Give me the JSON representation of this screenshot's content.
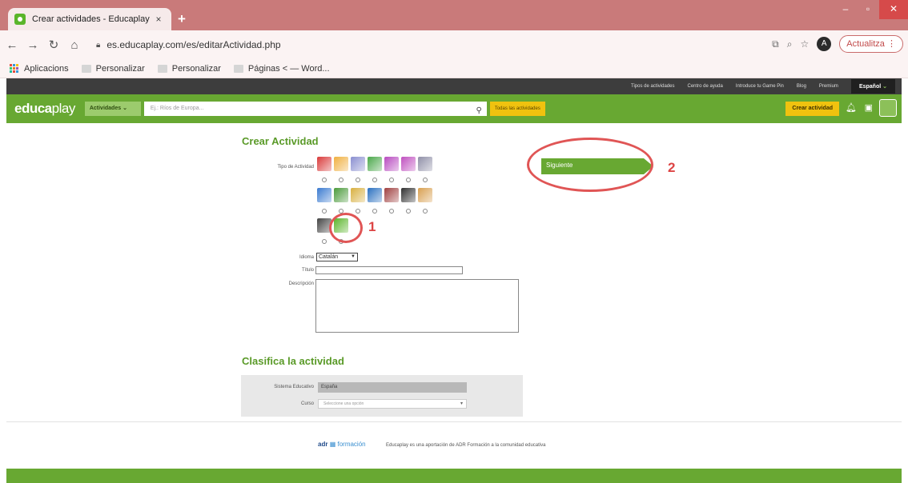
{
  "browser": {
    "tab_title": "Crear actividades - Educaplay",
    "tab_close": "×",
    "new_tab": "+",
    "url": "es.educaplay.com/es/editarActividad.php",
    "update_button": "Actualitza",
    "avatar_letter": "A",
    "bookmarks": [
      "Aplicacions",
      "Personalizar",
      "Personalizar",
      "Páginas < — Word..."
    ]
  },
  "site": {
    "top_links": [
      "Tipos de actividades",
      "Centro de ayuda",
      "Introduce tu Game Pin",
      "Blog",
      "Premium"
    ],
    "language": "Español",
    "logo_bold": "educa",
    "logo_rest": "play",
    "activities_dropdown": "Actividades",
    "search_placeholder": "Ej.: Ríos de Europa...",
    "all_activities": "Todas las actividades",
    "create_activity": "Crear actividad"
  },
  "form": {
    "heading": "Crear Actividad",
    "type_label": "Tipo de Actividad",
    "language_label": "Idioma",
    "language_value": "Catalán",
    "title_label": "Título",
    "description_label": "Descripción",
    "next_button": "Siguiente",
    "annotation_1": "1",
    "annotation_2": "2",
    "activity_icon_colors": [
      [
        "#d93a3a",
        "#f0b040",
        "#8a8fd0",
        "#4aa84a",
        "#b84ac0",
        "#c050c0",
        "#9090a8"
      ],
      [
        "#3a7ad0",
        "#4a9a3a",
        "#d8b040",
        "#2a70c0",
        "#a04040",
        "#303030",
        "#d8a050"
      ],
      [
        "#444444",
        "#5ab52a"
      ]
    ]
  },
  "classify": {
    "heading": "Clasifica la actividad",
    "system_label": "Sistema Educativo",
    "system_value": "España",
    "course_label": "Curso",
    "course_placeholder": "Seleccione una opción"
  },
  "footer": {
    "logo_a": "adr",
    "logo_b": "formación",
    "text": "Educaplay es una aportación de ADR Formación a la comunidad educativa"
  },
  "colors": {
    "brand_green": "#68a832",
    "accent_yellow": "#f0c20f",
    "annotation_red": "#e05555"
  }
}
